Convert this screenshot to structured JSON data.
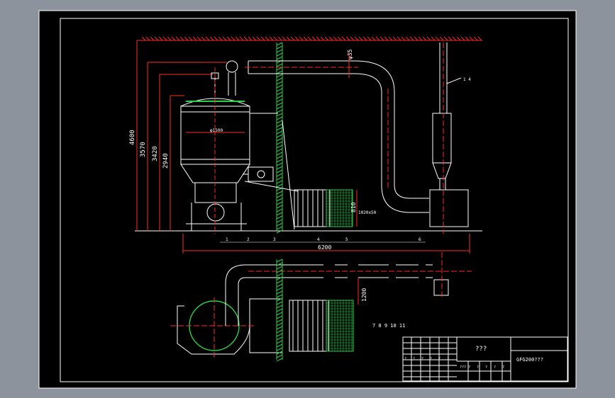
{
  "colors": {
    "background": "#8d939d",
    "paper": "#000000",
    "line_white": "#ffffff",
    "line_red": "#ff2a2a",
    "line_green": "#27d14a",
    "line_magenta": "#ff4dff",
    "line_yellow": "#e6e23a"
  },
  "dimensions": {
    "d4600": "4600",
    "d3570": "3570",
    "d3420": "3420",
    "d2940": "2940",
    "d6200": "6200",
    "d1200": "1200",
    "d810": "810",
    "phi35": "φ35",
    "phi1500": "φ1500",
    "flange": "1020x50"
  },
  "callouts": {
    "duct_label": "1 4",
    "bottom_1": "1",
    "bottom_2": "2",
    "bottom_3": "3",
    "bottom_4": "4",
    "bottom_5": "5",
    "bottom_6": "6"
  },
  "plan_note": "7 8 9 10 11",
  "title_block": {
    "title": "???",
    "drawing_no": "GFG200???",
    "cells": [
      "?",
      "?",
      "?",
      "?",
      "?",
      "?",
      "???",
      "?",
      "?",
      "?",
      "?",
      "?"
    ]
  }
}
